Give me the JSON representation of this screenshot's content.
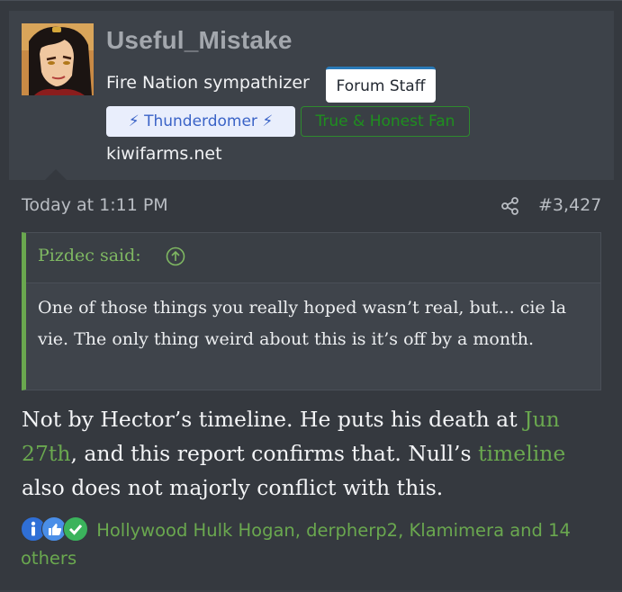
{
  "user": {
    "username": "Useful_Mistake",
    "title": "Fire Nation sympathizer",
    "staff_badge": "Forum Staff",
    "banner_thunder": "⚡ Thunderdomer ⚡",
    "banner_fan": "True & Honest Fan",
    "site": "kiwifarms.net"
  },
  "post": {
    "time": "Today at 1:11 PM",
    "number": "#3,427",
    "quote": {
      "author": "Pizdec said:",
      "text": "One of those things you really hoped wasn’t real, but... cie la vie. The only thing weird about this is it’s off by a month."
    },
    "body": {
      "part1": "Not by Hector’s timeline. He puts his death at ",
      "link1": "Jun 27th",
      "part2": ", and this report confirms that. Null’s ",
      "link2": "timeline",
      "part3": " also does not majorly conflict with this."
    },
    "reactions": {
      "icons": [
        "informative-icon",
        "like-icon",
        "agree-icon"
      ],
      "text": "Hollywood Hulk Hogan, derpherp2, Klamimera and 14 others"
    }
  },
  "colors": {
    "accent_green": "#6aa84f",
    "staff_border": "#2a7ab8",
    "thunder_text": "#3a63c7",
    "fan_green": "#1f8f1f"
  }
}
